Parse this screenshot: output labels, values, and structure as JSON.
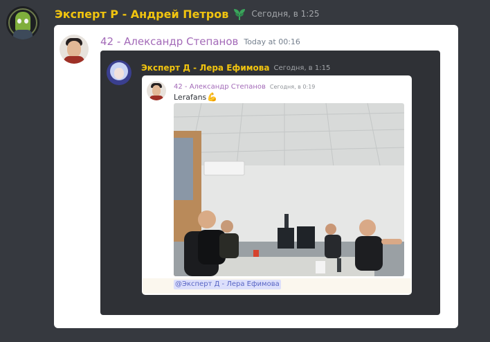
{
  "outer_message": {
    "author": "Эксперт Р - Андрей Петров",
    "timestamp": "Сегодня, в 1:25"
  },
  "quoted_message": {
    "author": "42 - Александр Степанов",
    "timestamp": "Today at 00:16"
  },
  "nested_message": {
    "author": "Эксперт Д - Лера Ефимова",
    "timestamp": "Сегодня, в 1:15"
  },
  "original_message": {
    "author": "42 - Александр Степанов",
    "timestamp": "Сегодня, в 0:19",
    "text": "Lerafans",
    "emoji": "💪",
    "mention": "@Эксперт Д - Лера Ефимова"
  },
  "colors": {
    "background": "#36393f",
    "expert_name": "#f1c40f",
    "member_name": "#a36ab8",
    "mention_bg": "#dcdffb"
  },
  "icons": [
    "sprout-icon",
    "flexed-biceps-emoji"
  ]
}
